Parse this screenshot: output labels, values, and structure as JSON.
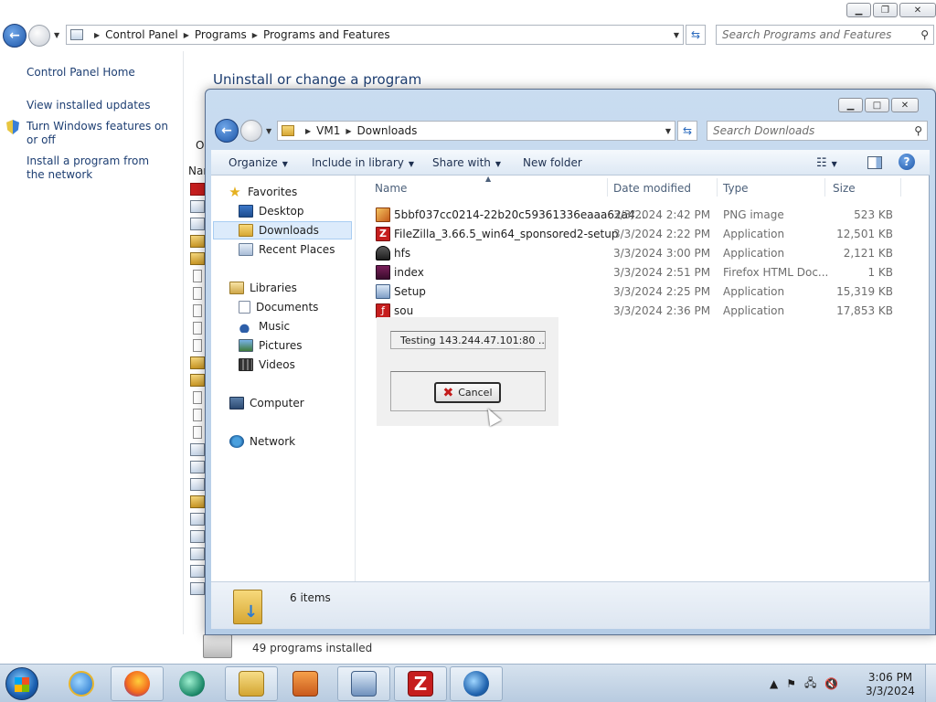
{
  "control_panel": {
    "breadcrumbs": [
      "Control Panel",
      "Programs",
      "Programs and Features"
    ],
    "search_placeholder": "Search Programs and Features",
    "left_links": [
      "Control Panel Home",
      "View installed updates",
      "Turn Windows features on or off",
      "Install a program from the network"
    ],
    "heading": "Uninstall or change a program",
    "organize_stub": "O",
    "name_stub": "Nar",
    "status": "49 programs installed"
  },
  "explorer": {
    "breadcrumbs": [
      "VM1",
      "Downloads"
    ],
    "search_placeholder": "Search Downloads",
    "commands": {
      "organize": "Organize",
      "include_in_library": "Include in library",
      "share_with": "Share with",
      "new_folder": "New folder"
    },
    "nav": {
      "favorites": "Favorites",
      "desktop": "Desktop",
      "downloads": "Downloads",
      "recent_places": "Recent Places",
      "libraries": "Libraries",
      "documents": "Documents",
      "music": "Music",
      "pictures": "Pictures",
      "videos": "Videos",
      "computer": "Computer",
      "network": "Network"
    },
    "columns": {
      "name": "Name",
      "date": "Date modified",
      "type": "Type",
      "size": "Size"
    },
    "files": [
      {
        "name": "5bbf037cc0214-22b20c59361336eaaa62a4...",
        "date": "3/3/2024 2:42 PM",
        "type": "PNG image",
        "size": "523 KB",
        "icon": "png-icon"
      },
      {
        "name": "FileZilla_3.66.5_win64_sponsored2-setup",
        "date": "3/3/2024 2:22 PM",
        "type": "Application",
        "size": "12,501 KB",
        "icon": "filezilla-icon"
      },
      {
        "name": "hfs",
        "date": "3/3/2024 3:00 PM",
        "type": "Application",
        "size": "2,121 KB",
        "icon": "hfs-icon"
      },
      {
        "name": "index",
        "date": "3/3/2024 2:51 PM",
        "type": "Firefox HTML Doc...",
        "size": "1 KB",
        "icon": "html-icon"
      },
      {
        "name": "Setup",
        "date": "3/3/2024 2:25 PM",
        "type": "Application",
        "size": "15,319 KB",
        "icon": "setup-icon"
      },
      {
        "name": "sou",
        "date": "3/3/2024 2:36 PM",
        "type": "Application",
        "size": "17,853 KB",
        "icon": "sou-icon"
      }
    ],
    "item_count": "6 items"
  },
  "popup": {
    "status": "Testing 143.244.47.101:80 ...",
    "cancel_label": "Cancel"
  },
  "taskbar": {
    "time": "3:06 PM",
    "date": "3/3/2024"
  }
}
